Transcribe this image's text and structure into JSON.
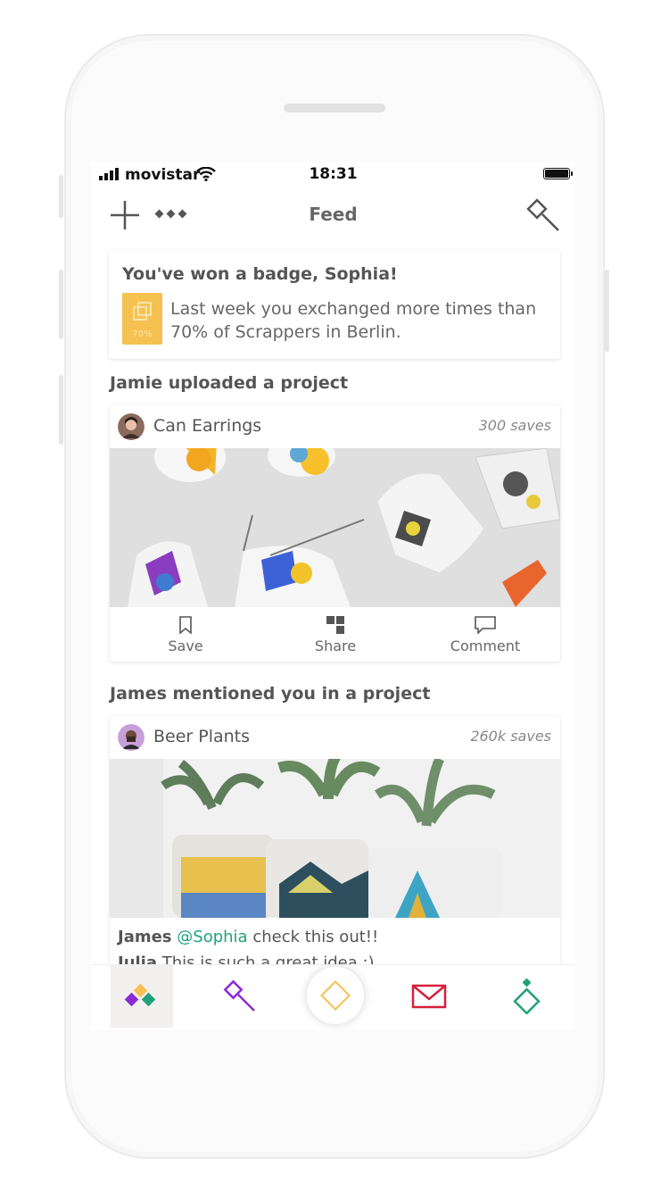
{
  "status": {
    "carrier": "movistar",
    "time": "18:31"
  },
  "header": {
    "title": "Feed"
  },
  "badge": {
    "title": "You've won a badge, Sophia!",
    "icon_label": "70%",
    "text": "Last week you exchanged more times than 70% of Scrappers in Berlin."
  },
  "feed": [
    {
      "heading": "Jamie uploaded a project",
      "project": "Can Earrings",
      "saves": "300 saves",
      "actions": {
        "save": "Save",
        "share": "Share",
        "comment": "Comment"
      }
    },
    {
      "heading": "James mentioned you in a project",
      "project": "Beer Plants",
      "saves": "260k saves",
      "comments": [
        {
          "author": "James",
          "mention": "@Sophia",
          "text": "check this out!!"
        },
        {
          "author": "Julia",
          "text": "This is such a great idea :)"
        }
      ]
    }
  ],
  "tabbar": {
    "items": [
      "feed-icon",
      "explore-hammer-icon",
      "scrap-diamond-icon",
      "messages-icon",
      "profile-icon"
    ]
  },
  "colors": {
    "accent_green": "#1fa27a",
    "purple": "#8a2bd6",
    "yellow": "#f5c150",
    "red": "#d61f3b"
  }
}
